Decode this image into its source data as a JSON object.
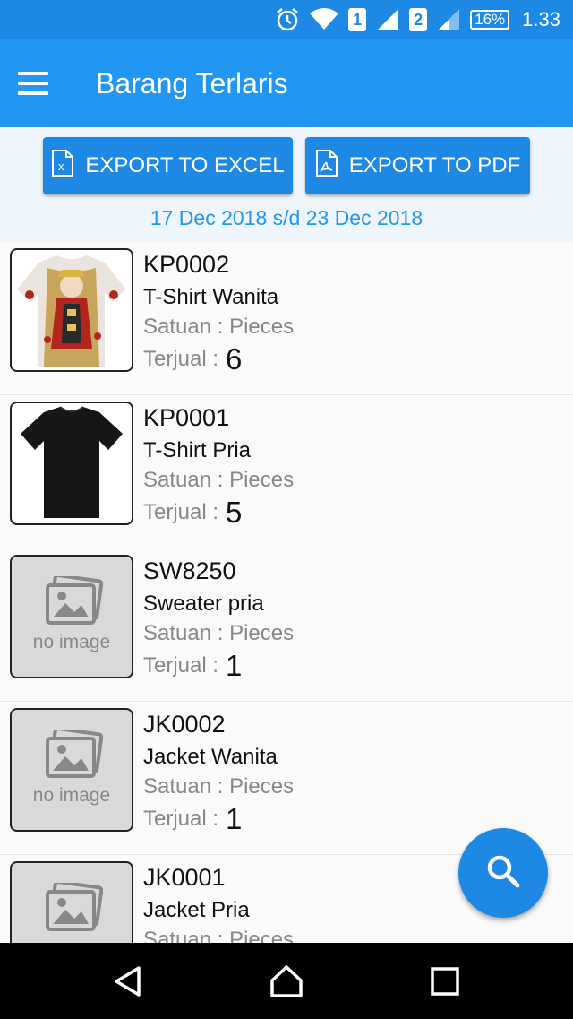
{
  "status_bar": {
    "sim1": "1",
    "sim2": "2",
    "battery": "16%",
    "time": "1.33",
    "icons": [
      "alarm-icon",
      "wifi-icon",
      "signal-icon",
      "signal-icon"
    ]
  },
  "app_bar": {
    "title": "Barang Terlaris",
    "menu_icon": "hamburger-menu-icon"
  },
  "export": {
    "excel_label": "EXPORT TO EXCEL",
    "pdf_label": "EXPORT TO PDF",
    "date_range": "17 Dec 2018 s/d 23 Dec 2018"
  },
  "items": [
    {
      "code": "KP0002",
      "name": "T-Shirt Wanita",
      "unit": "Satuan : Pieces",
      "sold_label": "Terjual :",
      "sold": "6",
      "image": "king-card-tshirt"
    },
    {
      "code": "KP0001",
      "name": "T-Shirt Pria",
      "unit": "Satuan : Pieces",
      "sold_label": "Terjual :",
      "sold": "5",
      "image": "black-tshirt"
    },
    {
      "code": "SW8250",
      "name": "Sweater pria",
      "unit": "Satuan : Pieces",
      "sold_label": "Terjual :",
      "sold": "1",
      "image": "no-image",
      "noimg_text": "no image"
    },
    {
      "code": "JK0002",
      "name": "Jacket Wanita",
      "unit": "Satuan : Pieces",
      "sold_label": "Terjual :",
      "sold": "1",
      "image": "no-image",
      "noimg_text": "no image"
    },
    {
      "code": "JK0001",
      "name": "Jacket Pria",
      "unit": "Satuan : Pieces",
      "image": "no-image"
    }
  ],
  "colors": {
    "primary": "#2196f3",
    "primary_dark": "#1e88e5",
    "date_text": "#2196f3"
  }
}
